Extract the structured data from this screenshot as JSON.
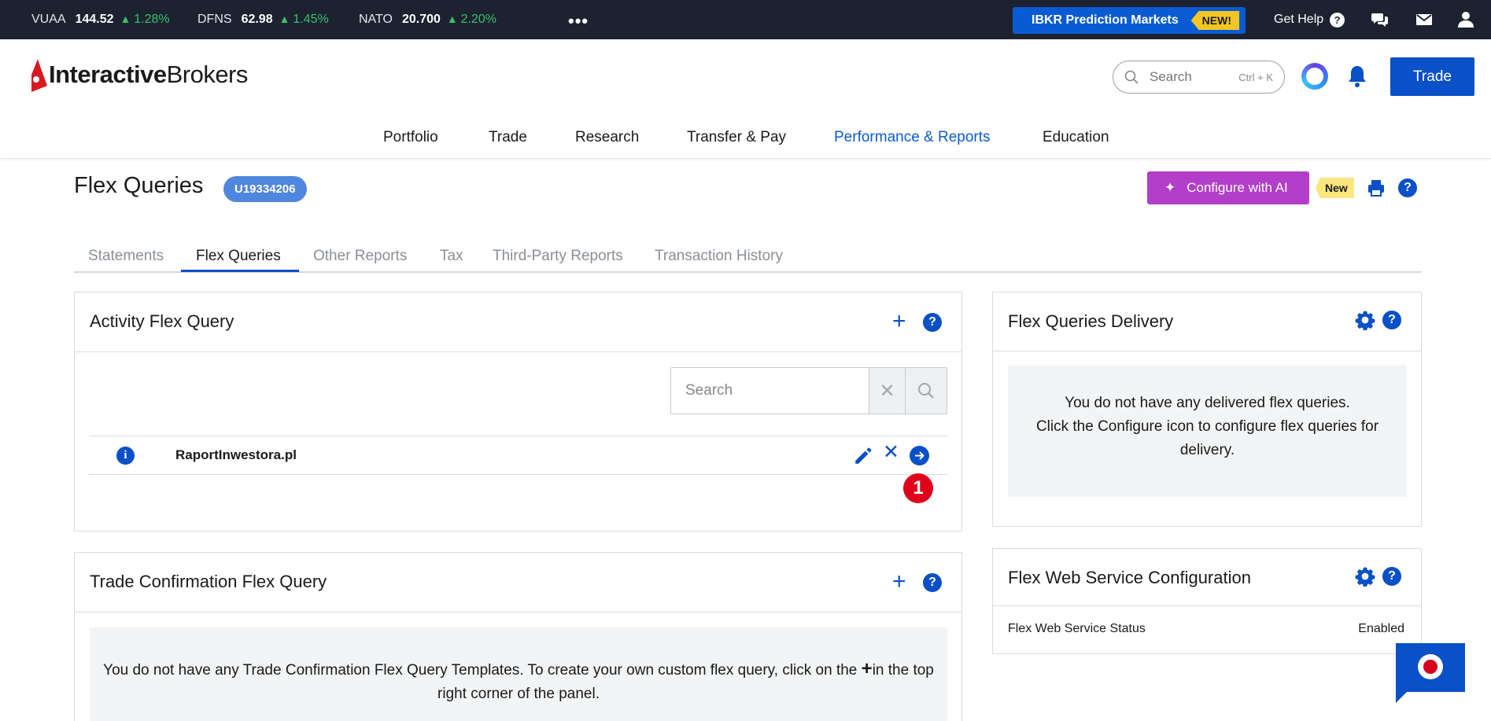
{
  "ticker": [
    {
      "symbol": "VUAA",
      "price": "144.52",
      "change": "1.28%"
    },
    {
      "symbol": "DFNS",
      "price": "62.98",
      "change": "1.45%"
    },
    {
      "symbol": "NATO",
      "price": "20.700",
      "change": "2.20%"
    }
  ],
  "topbar": {
    "more_label": "•••",
    "promo_label": "IBKR Prediction Markets",
    "promo_badge": "NEW!",
    "help_label": "Get Help",
    "help_glyph": "?",
    "icons": [
      "chat-bubbles-icon",
      "mail-icon",
      "user-icon"
    ]
  },
  "header": {
    "logo_bold": "Interactive",
    "logo_light": "Brokers",
    "search_placeholder": "Search",
    "search_shortcut": "Ctrl + K",
    "trade_label": "Trade"
  },
  "nav": {
    "items": [
      "Portfolio",
      "Trade",
      "Research",
      "Transfer & Pay",
      "Performance & Reports",
      "Education"
    ],
    "active": "Performance & Reports"
  },
  "page": {
    "title": "Flex Queries",
    "account": "U19334206",
    "ai_label": "Configure with AI",
    "ai_badge": "New",
    "help_glyph": "?"
  },
  "tabs": {
    "items": [
      "Statements",
      "Flex Queries",
      "Other Reports",
      "Tax",
      "Third-Party Reports",
      "Transaction History"
    ],
    "active": "Flex Queries"
  },
  "activity_panel": {
    "title": "Activity Flex Query",
    "add_glyph": "+",
    "search_placeholder": "Search",
    "clear_glyph": "✕",
    "queries": [
      {
        "name": "RaportInwestora.pl",
        "info_glyph": "i",
        "delete_glyph": "✕"
      }
    ],
    "marker": "1"
  },
  "trade_panel": {
    "title": "Trade Confirmation Flex Query",
    "add_glyph": "+",
    "empty_text_before": "You do not have any Trade Confirmation Flex Query Templates. To create your own custom flex query, click on the ",
    "plus_glyph": "+",
    "empty_text_after": "in the top right corner of the panel."
  },
  "delivery_panel": {
    "title": "Flex Queries Delivery",
    "empty_line1": "You do not have any delivered flex queries.",
    "empty_line2": "Click the Configure icon to configure flex queries for delivery."
  },
  "webservice_panel": {
    "title": "Flex Web Service Configuration",
    "status_label": "Flex Web Service Status",
    "status_value": "Enabled"
  },
  "colors": {
    "accent": "#0a50c8",
    "ticker_bg": "#1c2230",
    "positive": "#36c26a",
    "ai_purple": "#b23ec9",
    "marker_red": "#e0001b"
  }
}
